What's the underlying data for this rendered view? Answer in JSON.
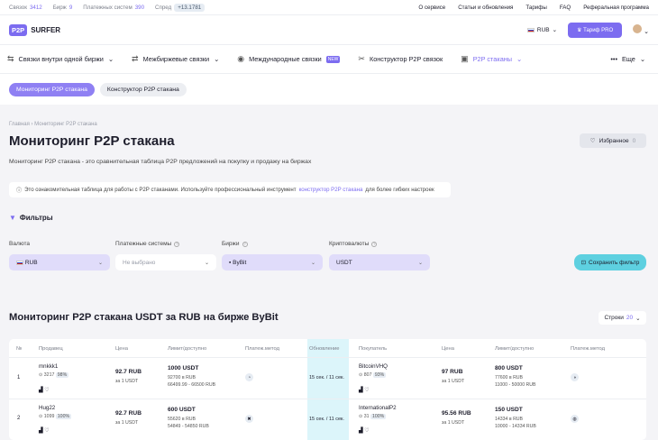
{
  "topbar": {
    "links_label": "Связок",
    "links_count": "3412",
    "exchanges_label": "Бирж",
    "exchanges_count": "9",
    "payment_label": "Платежных систем",
    "payment_count": "390",
    "spread_label": "Спред",
    "spread_value": "+13.1781",
    "nav": [
      "О сервисе",
      "Статьи и обновления",
      "Тарифы",
      "FAQ",
      "Реферальная программа"
    ]
  },
  "header": {
    "logo_mark": "P2P",
    "logo_text": "SURFER",
    "currency": "RUB",
    "pro_button": "Тариф PRO"
  },
  "nav": {
    "items": [
      {
        "label": "Связки внутри одной биржи",
        "icon": "arbitrage-icon"
      },
      {
        "label": "Межбиржевые связки",
        "icon": "cross-exchange-icon"
      },
      {
        "label": "Международные связки",
        "icon": "globe-icon",
        "badge": "NEW"
      },
      {
        "label": "Конструктор P2P связок",
        "icon": "tools-icon"
      },
      {
        "label": "P2P стаканы",
        "icon": "orderbook-icon"
      }
    ],
    "more": "Еще"
  },
  "subnav": {
    "tabs": [
      "Мониторинг P2P стакана",
      "Конструктор P2P стакана"
    ]
  },
  "page": {
    "breadcrumb": "Главная  ›  Мониторинг P2P стакана",
    "title": "Мониторинг P2P стакана",
    "favorites": "Избранное",
    "favorites_count": "0",
    "description": "Мониторинг P2P стакана - это сравнительная таблица P2P предложений на покупку и продажу на биржах",
    "note_before": "Это ознакомительная таблица для работы с P2P стаканами. Используйте профессиональный инструмент",
    "note_link": "конструктор P2P стакана",
    "note_after": "для более гибких настроек"
  },
  "filters": {
    "title": "Фильтры",
    "currency_label": "Валюта",
    "currency_value": "RUB",
    "payment_label": "Платежные системы",
    "payment_placeholder": "Не выбрано",
    "exchange_label": "Биржи",
    "exchange_value": "ByBit",
    "crypto_label": "Криптовалюты",
    "crypto_value": "USDT",
    "save_button": "Сохранить фильтр"
  },
  "table": {
    "title": "Мониторинг P2P стакана USDT за RUB на бирже ByBit",
    "rows_label": "Строки",
    "rows_value": "20",
    "headers": [
      "№",
      "Продавец",
      "Цена",
      "Лимит/доступно",
      "Платеж.метод",
      "Обновление",
      "Покупатель",
      "Цена",
      "Лимит/доступно",
      "Платеж.метод"
    ],
    "rows": [
      {
        "n": "1",
        "seller": "mnkkk1",
        "s_deals": "3217",
        "s_pct": "98%",
        "s_price": "92.7 RUB",
        "s_per": "за 1 USDT",
        "s_amount": "1000 USDT",
        "s_rub": "92700 в RUB",
        "s_limit": "66499.99 - 66500 RUB",
        "upd": "15 сек. / 11 сек.",
        "buyer": "BitcoinVHQ",
        "b_deals": "807",
        "b_pct": "93%",
        "b_price": "97 RUB",
        "b_per": "за 1 USDT",
        "b_amount": "800 USDT",
        "b_rub": "77600 в RUB",
        "b_limit": "11000 - 50000 RUB"
      },
      {
        "n": "2",
        "seller": "Hug22",
        "s_deals": "1099",
        "s_pct": "100%",
        "s_price": "92.7 RUB",
        "s_per": "за 1 USDT",
        "s_amount": "600 USDT",
        "s_rub": "55620 в RUB",
        "s_limit": "54849 - 54850 RUB",
        "upd": "15 сек. / 11 сек.",
        "buyer": "InternationalP2",
        "b_deals": "31",
        "b_pct": "100%",
        "b_price": "95.56 RUB",
        "b_per": "за 1 USDT",
        "b_amount": "150 USDT",
        "b_rub": "14334 в RUB",
        "b_limit": "10000 - 14334 RUB"
      }
    ]
  }
}
